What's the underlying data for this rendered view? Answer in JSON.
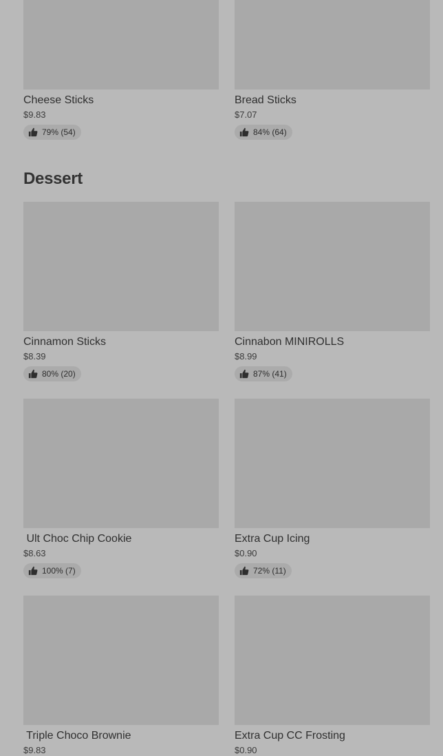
{
  "sections": [
    {
      "title": "",
      "items": [
        {
          "name": "Cheese Sticks",
          "price": "$9.83",
          "rating": "79% (54)"
        },
        {
          "name": "Bread Sticks",
          "price": "$7.07",
          "rating": "84% (64)"
        }
      ]
    },
    {
      "title": "Dessert",
      "items": [
        {
          "name": "Cinnamon Sticks",
          "price": "$8.39",
          "rating": "80% (20)"
        },
        {
          "name": "Cinnabon MINIROLLS",
          "price": "$8.99",
          "rating": "87% (41)"
        },
        {
          "name": " Ult Choc Chip Cookie",
          "price": "$8.63",
          "rating": "100% (7)"
        },
        {
          "name": "Extra Cup Icing",
          "price": "$0.90",
          "rating": "72% (11)"
        },
        {
          "name": " Triple Choco Brownie",
          "price": "$9.83",
          "rating": ""
        },
        {
          "name": "Extra Cup CC Frosting",
          "price": "$0.90",
          "rating": ""
        }
      ]
    }
  ],
  "icons": {
    "rating": "thumbs-up-icon"
  },
  "colors": {
    "background": "#b9b9b9",
    "image_placeholder": "#a9a9a9",
    "rating_pill": "#ababab",
    "text": "#2e2e2e"
  }
}
